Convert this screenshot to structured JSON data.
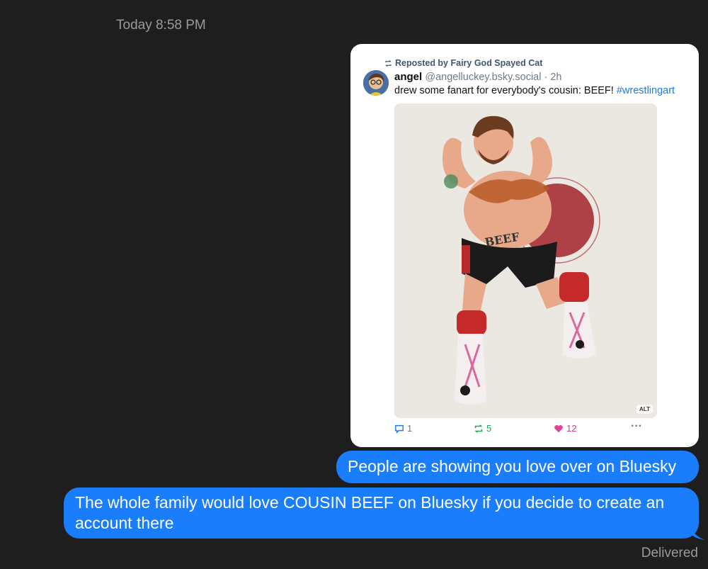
{
  "thread": {
    "timestamp": "Today 8:58 PM",
    "status": "Delivered"
  },
  "post": {
    "repost_label": "Reposted by Fairy God Spayed Cat",
    "author_name": "angel",
    "author_meta": "@angelluckey.bsky.social · 2h",
    "text_main": "drew some fanart for everybody's cousin: BEEF! ",
    "hashtag": "#wrestlingart",
    "image_alt_badge": "ALT",
    "tattoo_text": "BEEF",
    "reply_count": "1",
    "repost_count": "5",
    "like_count": "12",
    "more_label": "···"
  },
  "messages": [
    {
      "text": "People are showing you love over on Bluesky"
    },
    {
      "text": "The whole family would love COUSIN BEEF on Bluesky if you decide to create an account there"
    }
  ],
  "colors": {
    "background": "#1e1e1e",
    "bubble": "#1a7dfb",
    "hashtag": "#1d7ce0",
    "repost_green": "#1faa59",
    "like_pink": "#d43a8a"
  }
}
